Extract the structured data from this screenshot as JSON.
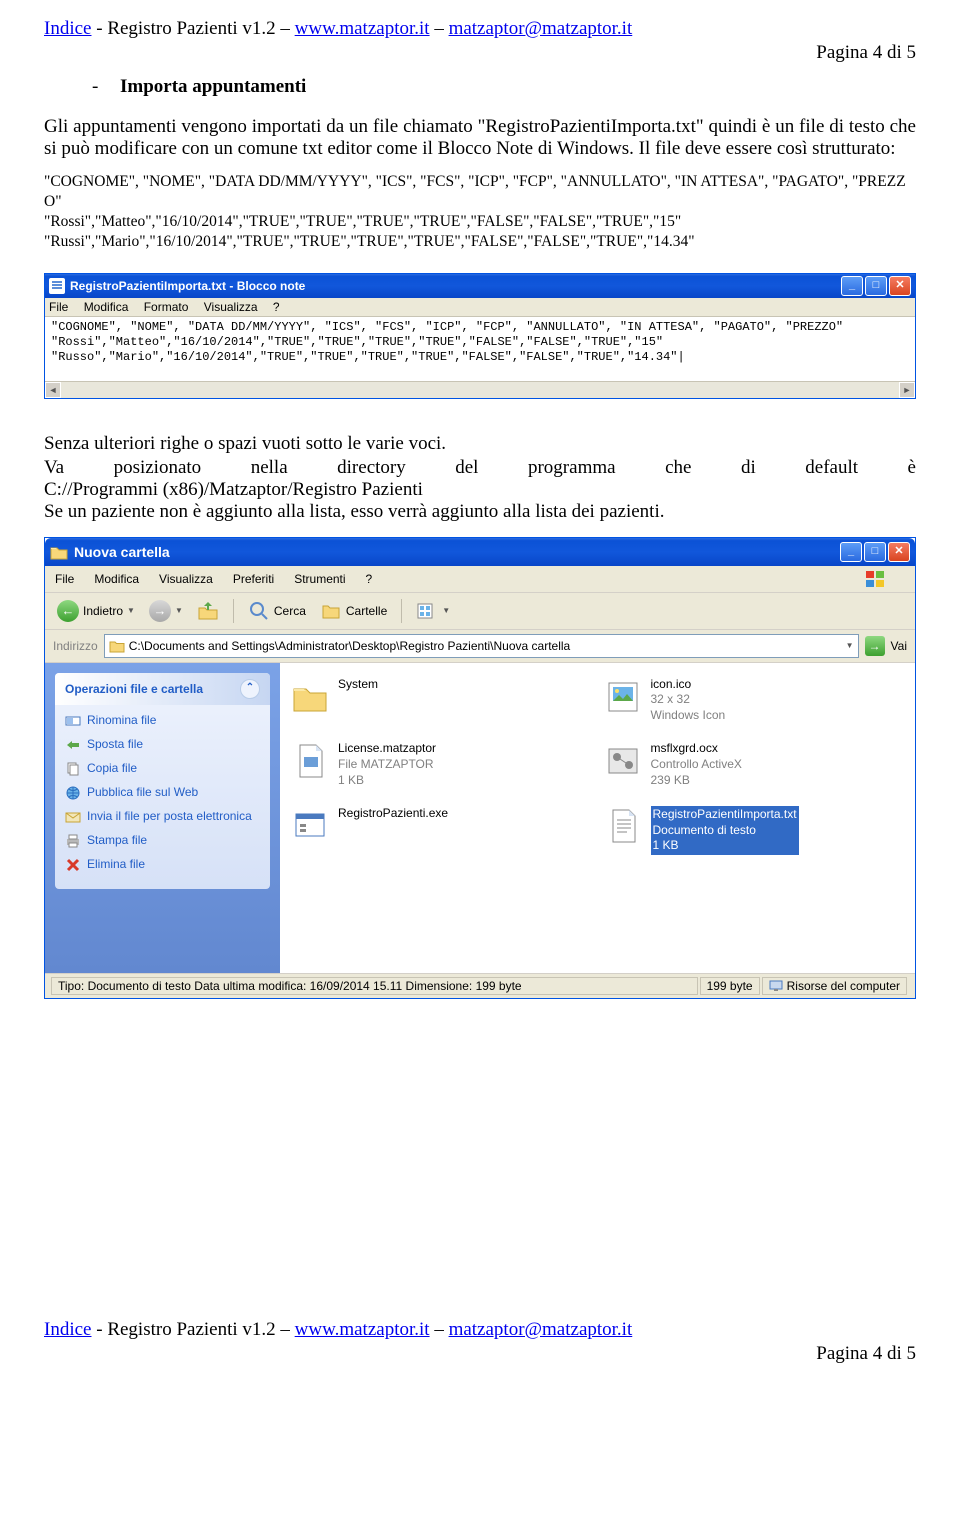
{
  "header": {
    "indice": "Indice",
    "sep1": " - ",
    "product": "Registro Pazienti v1.2",
    "sep2": " – ",
    "url": "www.matzaptor.it",
    "sep3": " – ",
    "email": "matzaptor@matzaptor.it"
  },
  "page_num_top": "Pagina 4 di 5",
  "bullet": {
    "dash": "-",
    "label": "Importa appuntamenti"
  },
  "para1": "Gli appuntamenti vengono importati da un file chiamato \"RegistroPazientiImporta.txt\" quindi è un file di testo che si può modificare con un comune txt editor come il Blocco Note di Windows. Il file deve essere così strutturato:",
  "code": {
    "l1": "\"COGNOME\", \"NOME\", \"DATA DD/MM/YYYY\", \"ICS\", \"FCS\", \"ICP\", \"FCP\", \"ANNULLATO\", \"IN ATTESA\", \"PAGATO\", \"PREZZO\"",
    "l2": "\"Rossi\",\"Matteo\",\"16/10/2014\",\"TRUE\",\"TRUE\",\"TRUE\",\"TRUE\",\"FALSE\",\"FALSE\",\"TRUE\",\"15\"",
    "l3": "\"Russi\",\"Mario\",\"16/10/2014\",\"TRUE\",\"TRUE\",\"TRUE\",\"TRUE\",\"FALSE\",\"FALSE\",\"TRUE\",\"14.34\""
  },
  "notepad": {
    "title": "RegistroPazientiImporta.txt - Blocco note",
    "menu": {
      "file": "File",
      "modifica": "Modifica",
      "formato": "Formato",
      "visualizza": "Visualizza",
      "help": "?"
    },
    "content": "\"COGNOME\", \"NOME\", \"DATA DD/MM/YYYY\", \"ICS\", \"FCS\", \"ICP\", \"FCP\", \"ANNULLATO\", \"IN ATTESA\", \"PAGATO\", \"PREZZO\"\n\"Rossi\",\"Matteo\",\"16/10/2014\",\"TRUE\",\"TRUE\",\"TRUE\",\"TRUE\",\"FALSE\",\"FALSE\",\"TRUE\",\"15\"\n\"Russo\",\"Mario\",\"16/10/2014\",\"TRUE\",\"TRUE\",\"TRUE\",\"TRUE\",\"FALSE\",\"FALSE\",\"TRUE\",\"14.34\"|"
  },
  "para2": "Senza ulteriori righe o spazi vuoti sotto le varie voci.",
  "just": {
    "w1": "Va",
    "w2": "posizionato",
    "w3": "nella",
    "w4": "directory",
    "w5": "del",
    "w6": "programma",
    "w7": "che",
    "w8": "di",
    "w9": "default",
    "w10": "è"
  },
  "para3a": "C://Programmi (x86)/Matzaptor/Registro Pazienti",
  "para3b": "Se un paziente non è aggiunto alla lista, esso verrà aggiunto alla lista dei pazienti.",
  "explorer": {
    "title": "Nuova cartella",
    "menu": {
      "file": "File",
      "modifica": "Modifica",
      "visualizza": "Visualizza",
      "preferiti": "Preferiti",
      "strumenti": "Strumenti",
      "help": "?"
    },
    "toolbar": {
      "indietro": "Indietro",
      "cerca": "Cerca",
      "cartelle": "Cartelle"
    },
    "address": {
      "label": "Indirizzo",
      "path": "C:\\Documents and Settings\\Administrator\\Desktop\\Registro Pazienti\\Nuova cartella",
      "vai": "Vai"
    },
    "tasks": {
      "header": "Operazioni file e cartella",
      "items": [
        "Rinomina file",
        "Sposta file",
        "Copia file",
        "Pubblica file sul Web",
        "Invia il file per posta elettronica",
        "Stampa file",
        "Elimina file"
      ]
    },
    "files": [
      {
        "name": "System",
        "meta1": "",
        "meta2": ""
      },
      {
        "name": "icon.ico",
        "meta1": "32 x 32",
        "meta2": "Windows Icon"
      },
      {
        "name": "License.matzaptor",
        "meta1": "File MATZAPTOR",
        "meta2": "1 KB"
      },
      {
        "name": "msflxgrd.ocx",
        "meta1": "Controllo ActiveX",
        "meta2": "239 KB"
      },
      {
        "name": "RegistroPazienti.exe",
        "meta1": "",
        "meta2": ""
      },
      {
        "name": "RegistroPazientiImporta.txt",
        "meta1": "Documento di testo",
        "meta2": "1 KB"
      }
    ],
    "status": {
      "left": "Tipo: Documento di testo Data ultima modifica: 16/09/2014 15.11 Dimensione: 199 byte",
      "mid": "199 byte",
      "right": "Risorse del computer"
    }
  },
  "page_num_bottom": "Pagina 4 di 5"
}
